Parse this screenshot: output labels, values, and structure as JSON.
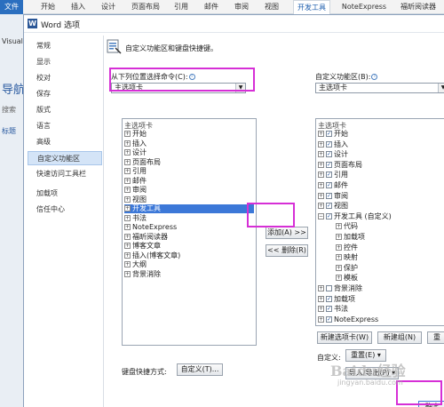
{
  "ribbon": {
    "tabs": [
      "文件",
      "开始",
      "插入",
      "设计",
      "页面布局",
      "引用",
      "邮件",
      "审阅",
      "视图",
      "开发工具",
      "NoteExpress",
      "福昕阅读器"
    ],
    "active": "开发工具"
  },
  "background": {
    "visual": "Visual",
    "nav": "导航",
    "search": "搜索",
    "title": "标题"
  },
  "dialog": {
    "title": "Word 选项",
    "nav_items": [
      "常规",
      "显示",
      "校对",
      "保存",
      "版式",
      "语言",
      "高级",
      "自定义功能区",
      "快速访问工具栏",
      "加载项",
      "信任中心"
    ],
    "nav_active": "自定义功能区",
    "header": "自定义功能区和键盘快捷键。",
    "choose_from_label": "从下列位置选择命令(C):",
    "choose_from_value": "主选项卡",
    "customize_label": "自定义功能区(B):",
    "customize_value": "主选项卡",
    "left_list": {
      "header": "主选项卡",
      "items": [
        "开始",
        "插入",
        "设计",
        "页面布局",
        "引用",
        "邮件",
        "审阅",
        "视图",
        "开发工具",
        "书法",
        "NoteExpress",
        "福昕阅读器",
        "博客文章",
        "插入(博客文章)",
        "大纲",
        "背景消除"
      ],
      "selected": "开发工具"
    },
    "right_list": {
      "header": "主选项卡",
      "items": [
        {
          "label": "开始",
          "level": 0,
          "checked": true
        },
        {
          "label": "插入",
          "level": 0,
          "checked": true
        },
        {
          "label": "设计",
          "level": 0,
          "checked": true
        },
        {
          "label": "页面布局",
          "level": 0,
          "checked": true
        },
        {
          "label": "引用",
          "level": 0,
          "checked": true
        },
        {
          "label": "邮件",
          "level": 0,
          "checked": true
        },
        {
          "label": "审阅",
          "level": 0,
          "checked": true
        },
        {
          "label": "视图",
          "level": 0,
          "checked": true
        },
        {
          "label": "开发工具 (自定义)",
          "level": 0,
          "checked": true,
          "expanded": true
        },
        {
          "label": "代码",
          "level": 1
        },
        {
          "label": "加载项",
          "level": 1
        },
        {
          "label": "控件",
          "level": 1
        },
        {
          "label": "映射",
          "level": 1
        },
        {
          "label": "保护",
          "level": 1
        },
        {
          "label": "模板",
          "level": 1
        },
        {
          "label": "背景消除",
          "level": 0,
          "checked": false
        },
        {
          "label": "加载项",
          "level": 0,
          "checked": true
        },
        {
          "label": "书法",
          "level": 0,
          "checked": true
        },
        {
          "label": "NoteExpress",
          "level": 0,
          "checked": true
        }
      ]
    },
    "add_button": "添加(A) >>",
    "remove_button": "<< 删除(R)",
    "new_tab_button": "新建选项卡(W)",
    "new_group_button": "新建组(N)",
    "rename_button": "重",
    "customize_label2": "自定义:",
    "reset_button": "重置(E) ▾",
    "import_export_button": "导入/导出(P) ▾",
    "keyboard_label": "键盘快捷方式:",
    "keyboard_button": "自定义(T)...",
    "ok_button": "确定"
  },
  "watermark": {
    "main": "Baidu经验",
    "sub": "jingyan.baidu.com"
  }
}
